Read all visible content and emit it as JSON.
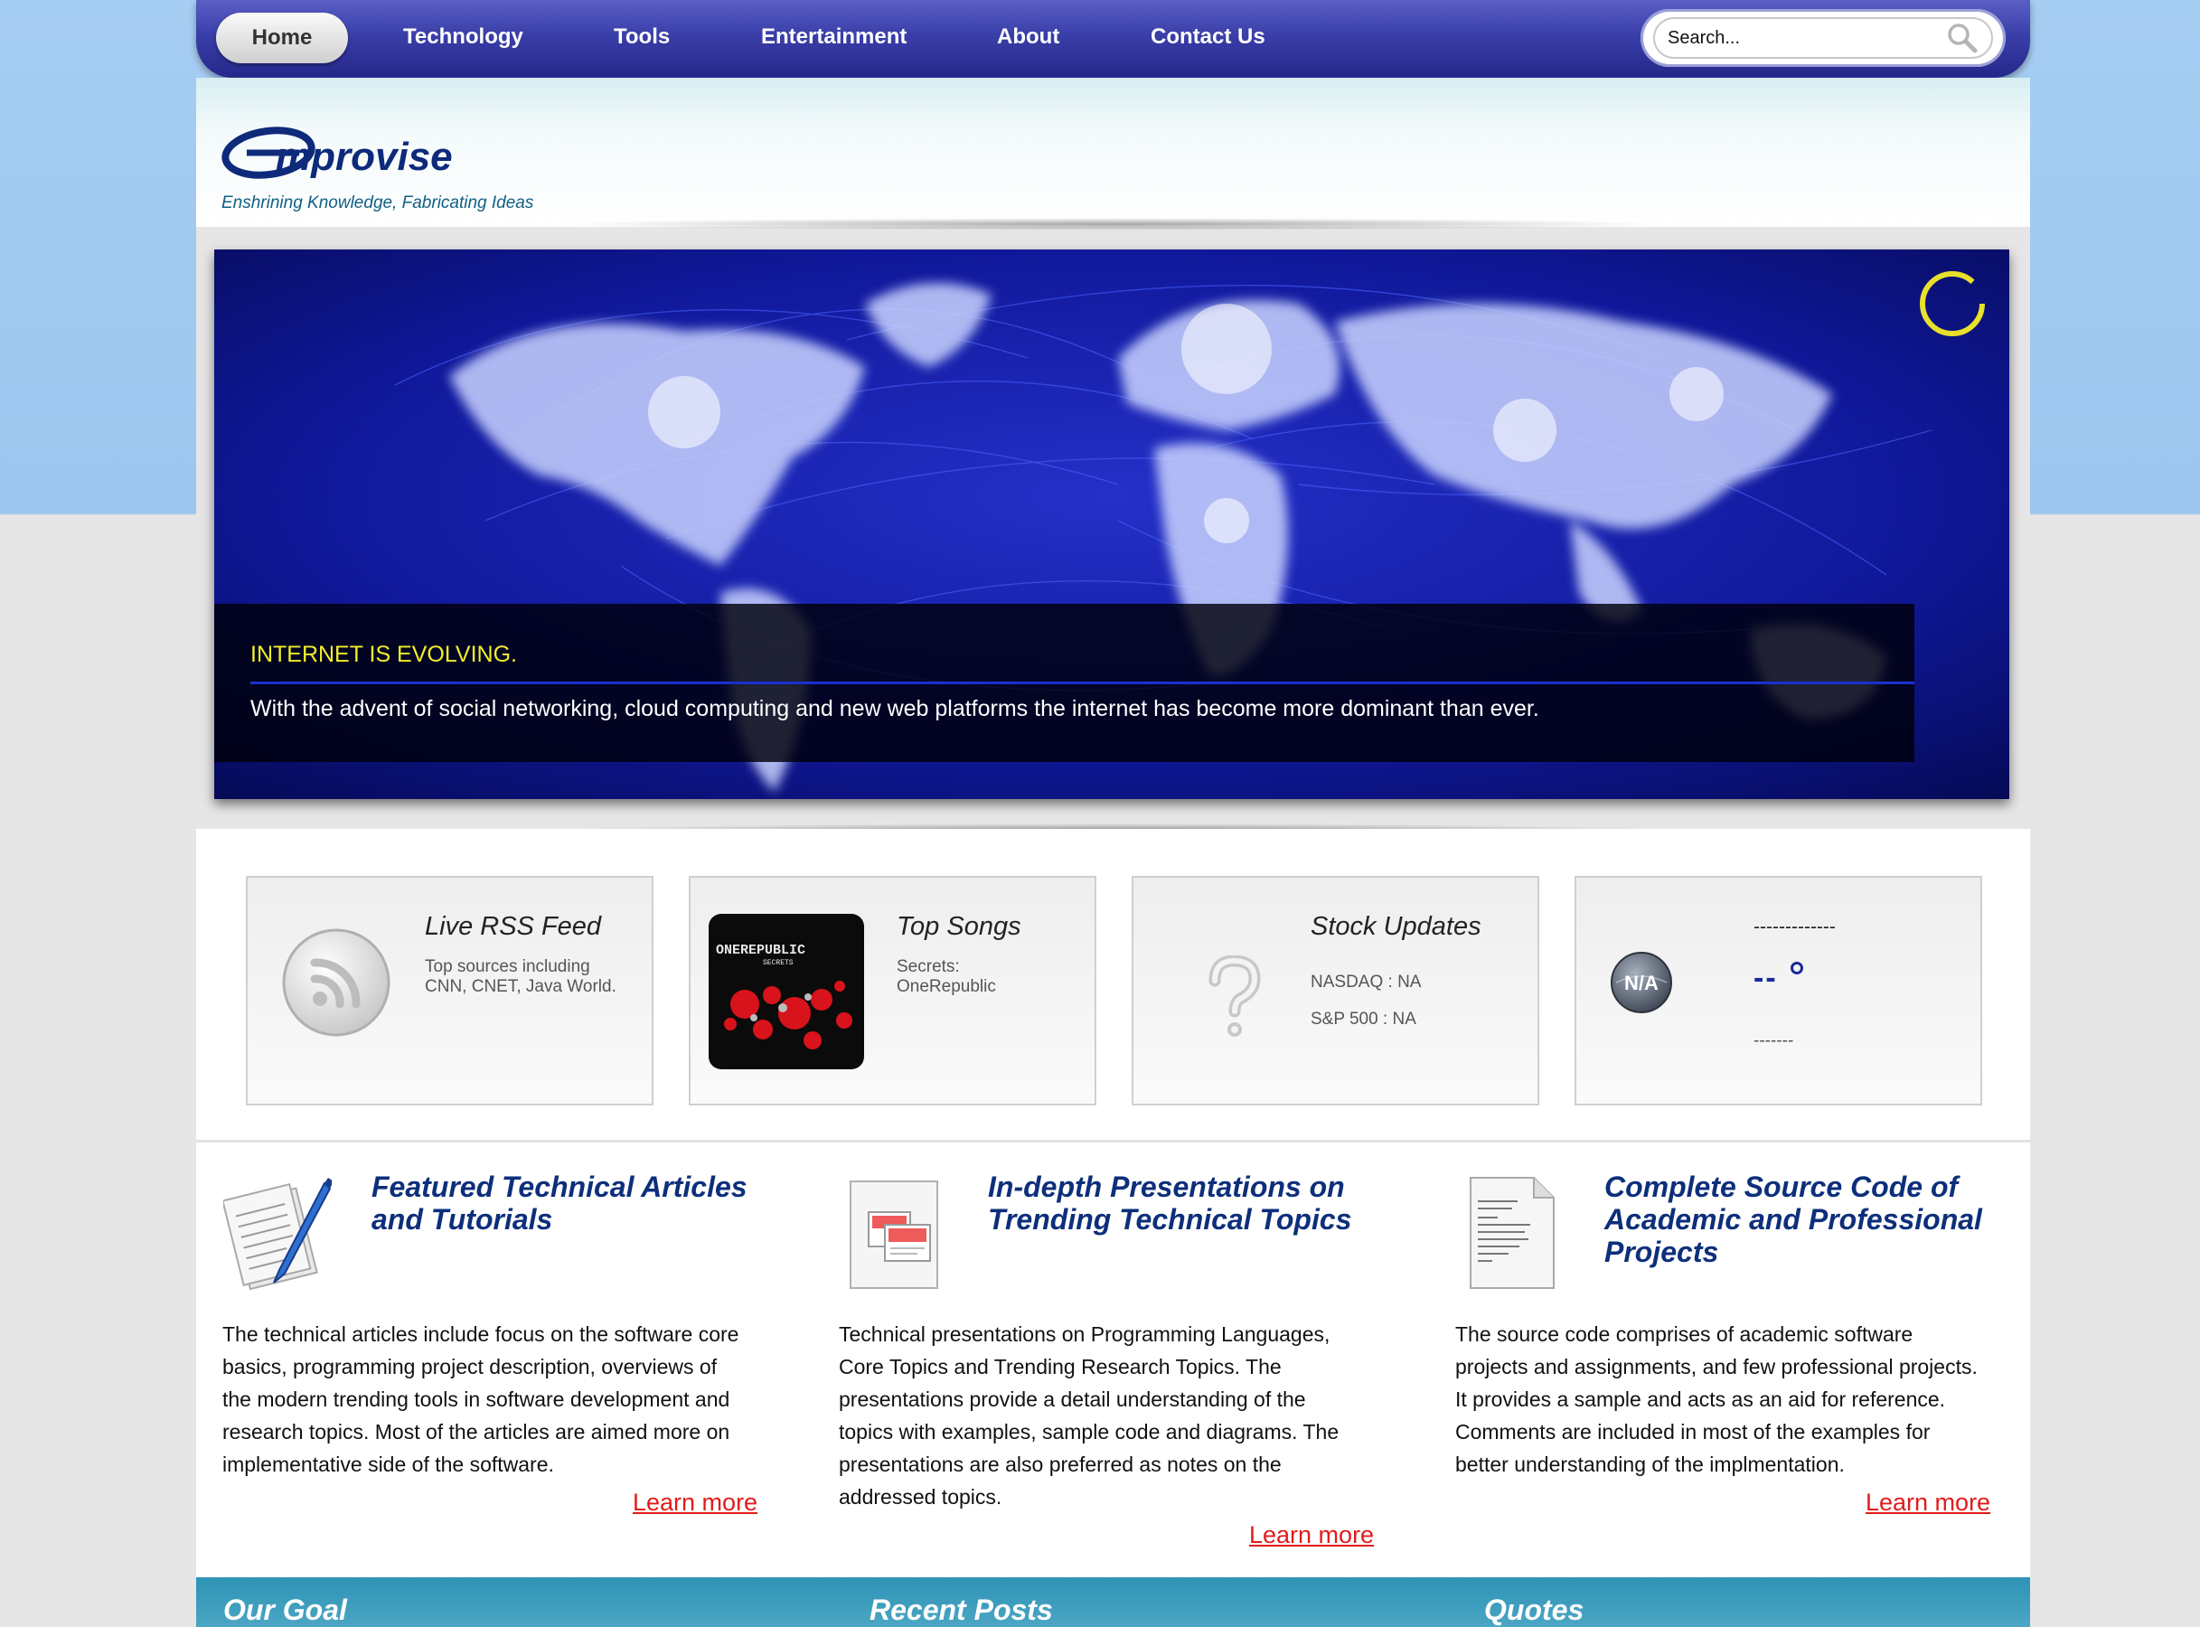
{
  "nav": {
    "items": [
      "Home",
      "Technology",
      "Tools",
      "Entertainment",
      "About",
      "Contact Us"
    ],
    "search_placeholder": "Search..."
  },
  "header": {
    "logo_text": "Emprovise",
    "tagline": "Enshrining Knowledge, Fabricating Ideas"
  },
  "slider": {
    "title": "INTERNET IS EVOLVING.",
    "text": "With the advent of social networking, cloud computing and new web platforms the internet has become more dominant than ever."
  },
  "widgets": {
    "rss": {
      "title": "Live RSS Feed",
      "text": "Top sources including CNN, CNET, Java World.",
      "icon": "rss-icon"
    },
    "songs": {
      "title": "Top Songs",
      "song": "Secrets:",
      "artist": "OneRepublic",
      "album_band": "ONEREPUBLIC",
      "album_title": "SECRETS"
    },
    "stocks": {
      "title": "Stock Updates",
      "nasdaq": "NASDAQ : NA",
      "sp500": "S&P 500 : NA",
      "icon": "question-mark-icon"
    },
    "weather": {
      "line1": "-------------",
      "temp": "--",
      "line2": "-------",
      "icon_text": "N/A"
    }
  },
  "features": [
    {
      "title_line1": "Featured Technical Articles",
      "title_line2": "and Tutorials",
      "text": [
        "The technical articles include focus on the software core",
        "basics, programming project description, overviews of",
        "the modern trending tools in software development and",
        "research topics. Most of the articles are aimed more on",
        "implementative side of the software."
      ],
      "link": "Learn more",
      "icon": "article-pen-icon"
    },
    {
      "title_line1": "In-depth Presentations on",
      "title_line2": "Trending Technical Topics",
      "text": [
        "Technical presentations on Programming Languages,",
        "Core Topics and Trending Research Topics. The",
        "presentations provide a detail understanding of the",
        "topics with examples, sample code and diagrams. The",
        "presentations are also preferred as notes on the",
        "addressed topics."
      ],
      "link": "Learn more",
      "icon": "presentation-icon"
    },
    {
      "title_line1": "Complete Source Code of",
      "title_line2": "Academic and Professional",
      "title_line3": "Projects",
      "text": [
        "The source code comprises of academic software",
        "projects and assignments, and few professional projects.",
        "It provides a sample and acts as an aid for reference.",
        "Comments are included in most of the examples for",
        "better understanding of the implmentation."
      ],
      "link": "Learn more",
      "icon": "source-code-icon"
    }
  ],
  "footer": {
    "sections": [
      "Our Goal",
      "Recent Posts",
      "Quotes"
    ]
  },
  "colors": {
    "nav_blue": "#3a3ea8",
    "feature_title": "#0d2f7b",
    "link_red": "#e21b1b",
    "caption_yellow": "#f2ee2a",
    "footer_teal": "#2e93b5"
  }
}
